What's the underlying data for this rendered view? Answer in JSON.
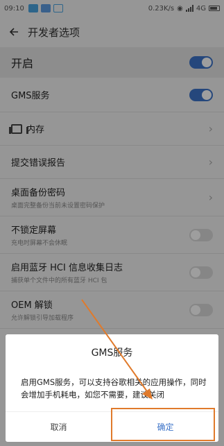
{
  "status": {
    "time": "09:10",
    "net_speed": "0.23K/s",
    "network": "4G"
  },
  "header": {
    "title": "开发者选项"
  },
  "master": {
    "label": "开启"
  },
  "rows": [
    {
      "title": "GMS服务"
    },
    {
      "title": "内存"
    },
    {
      "title": "提交错误报告"
    },
    {
      "title": "桌面备份密码",
      "subtitle": "桌面完整备份当前未设置密码保护"
    },
    {
      "title": "不锁定屏幕",
      "subtitle": "充电时屏幕不会休眠"
    },
    {
      "title": "启用蓝牙 HCI 信息收集日志",
      "subtitle": "捕获单个文件中的所有蓝牙 HCI 包"
    },
    {
      "title": "OEM 解锁",
      "subtitle": "允许解锁引导加载程序"
    }
  ],
  "dialog": {
    "title": "GMS服务",
    "message": "启用GMS服务，可以支持谷歌相关的应用操作，同时会增加手机耗电，如您不需要，建议关闭",
    "cancel": "取消",
    "confirm": "确定"
  },
  "colors": {
    "accent": "#3c73c8",
    "annotation": "#e07a2b"
  },
  "icons": {
    "back": "arrow-left-icon",
    "chevron": "chevron-right-icon",
    "memory": "memory-chip-icon"
  }
}
